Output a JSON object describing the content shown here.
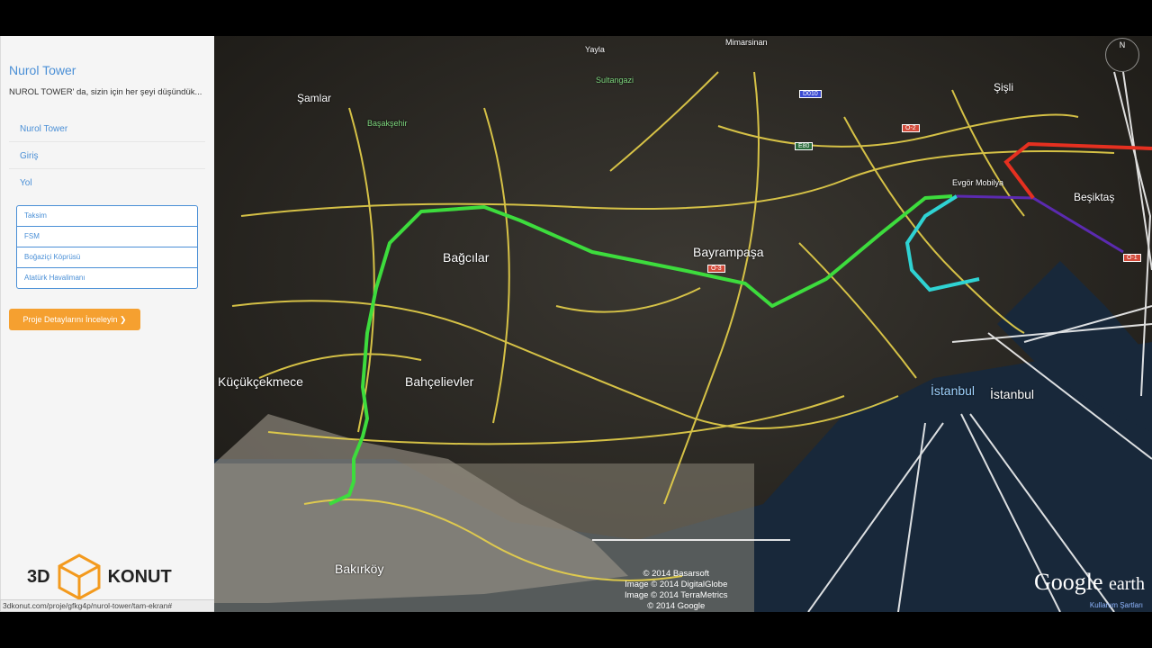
{
  "sidebar": {
    "title": "Nurol Tower",
    "subtitle": "NUROL TOWER' da, sizin için her şeyi düşündük...",
    "nav": [
      "Nurol Tower",
      "Giriş",
      "Yol"
    ],
    "subitems": [
      "Taksim",
      "FSM",
      "Boğaziçi Köprüsü",
      "Atatürk Havalimanı"
    ],
    "cta": "Proje Detaylarını İnceleyin ❯",
    "logo_left": "3D",
    "logo_right": "KONUT"
  },
  "status_url": "3dkonut.com/proje/gfkg4p/nurol-tower/tam-ekran#",
  "map": {
    "labels": {
      "yayla": "Yayla",
      "mimarsinan": "Mimarsinan",
      "samlar": "Şamlar",
      "sultangazi": "Sultangazi",
      "sisli": "Şişli",
      "basaksehir": "Başakşehir",
      "evgor": "Evgör Mobilya",
      "besiktas": "Beşiktaş",
      "bagcilar": "Bağcılar",
      "bayrampasa": "Bayrampaşa",
      "kucukcekmece": "Küçükçekmece",
      "bahcelievler": "Bahçelievler",
      "istanbul1": "İstanbul",
      "istanbul2": "İstanbul",
      "bakirkoy": "Bakırköy"
    },
    "road_badges": [
      "D010",
      "E80",
      "O-2",
      "O-3",
      "O-1"
    ],
    "copyright": [
      "© 2014 Basarsoft",
      "Image © 2014 DigitalGlobe",
      "Image © 2014 TerraMetrics",
      "© 2014 Google"
    ],
    "brand": "Google",
    "brand2": "earth",
    "terms": "Kullanım Şartları",
    "compass": "N"
  },
  "colors": {
    "route": "#3ddc3d",
    "route_cyan": "#2fd3d3",
    "route_red": "#e53020",
    "route_purple": "#5b2ab0",
    "roads": "#e8d24a"
  }
}
